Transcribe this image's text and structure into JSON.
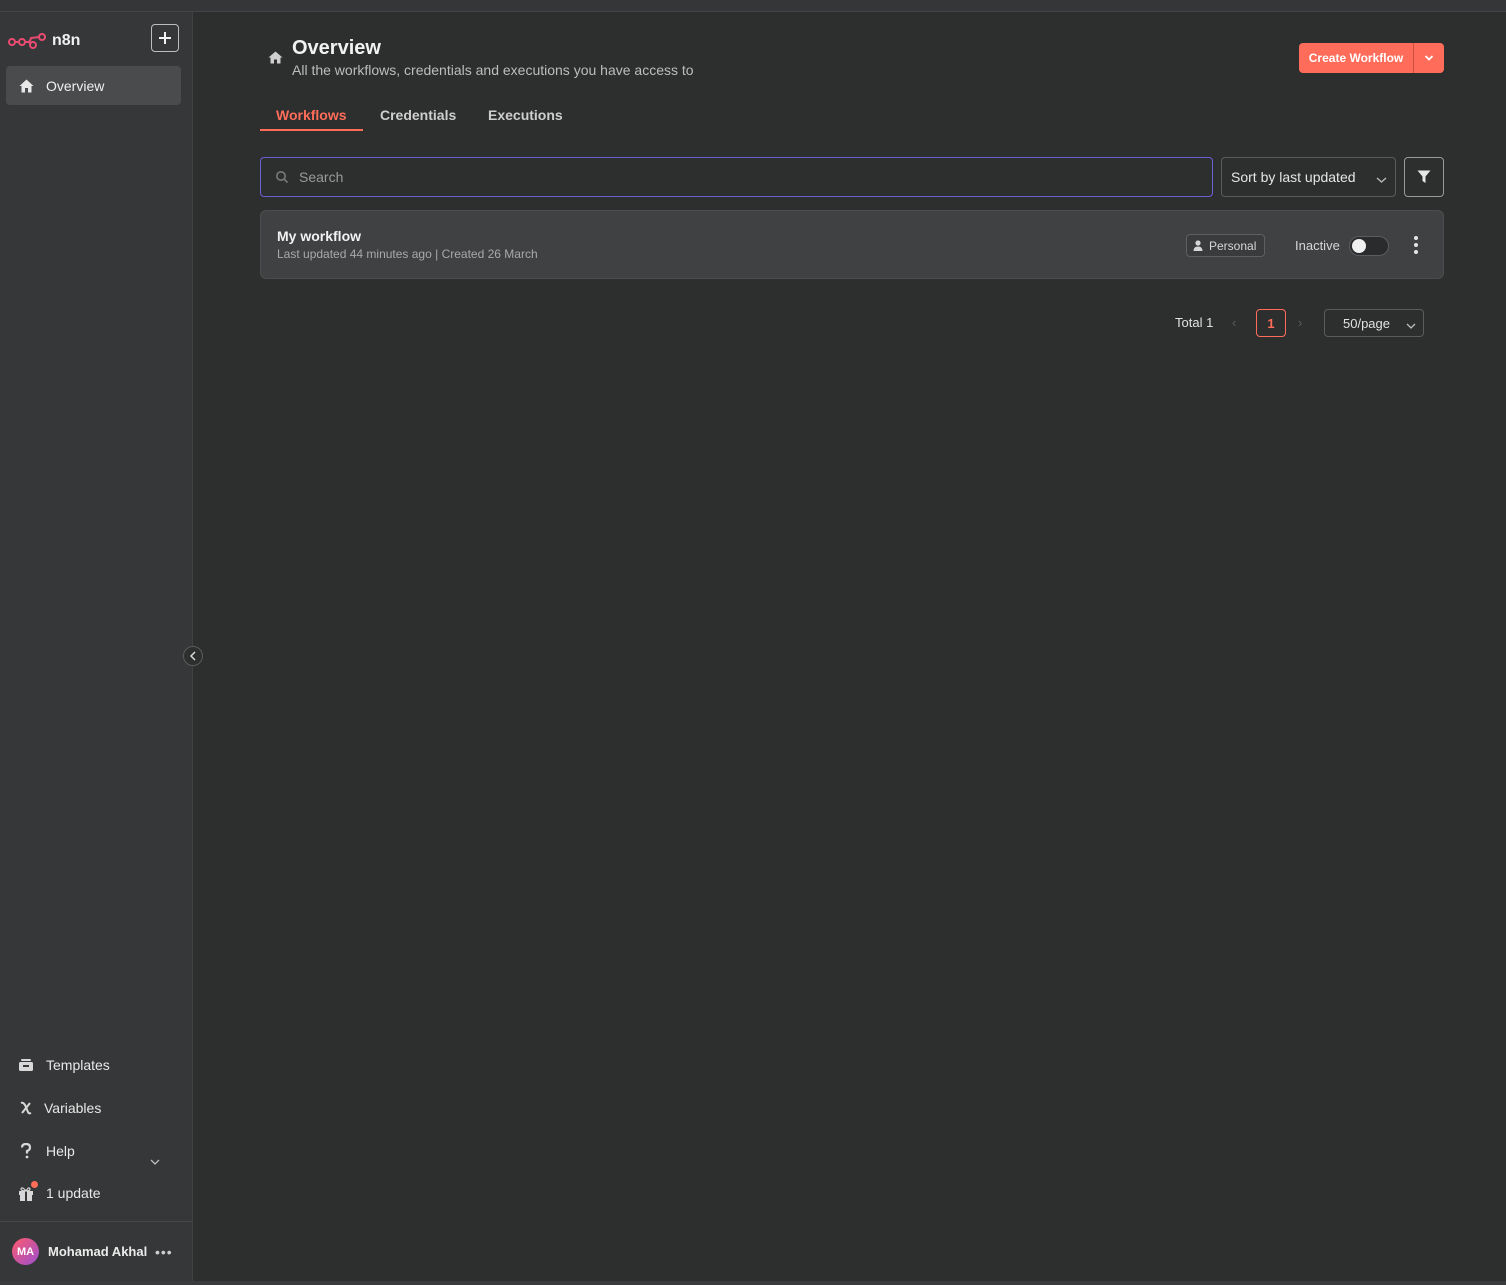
{
  "app": {
    "brand": "n8n",
    "accent_color": "#ff6d5a"
  },
  "sidebar": {
    "add_button_icon": "plus-icon",
    "items": [
      {
        "label": "Overview",
        "icon": "home-icon",
        "active": true
      }
    ],
    "bottom_items": [
      {
        "label": "Templates",
        "icon": "templates-icon"
      },
      {
        "label": "Variables",
        "icon": "variables-icon"
      },
      {
        "label": "Help",
        "icon": "help-icon"
      },
      {
        "label": "1 update",
        "icon": "gift-icon"
      }
    ],
    "user": {
      "initials": "MA",
      "name": "Mohamad Akhal"
    }
  },
  "header": {
    "title": "Overview",
    "subtitle": "All the workflows, credentials and executions you have access to",
    "create_button": "Create Workflow"
  },
  "tabs": [
    {
      "label": "Workflows",
      "active": true
    },
    {
      "label": "Credentials",
      "active": false
    },
    {
      "label": "Executions",
      "active": false
    }
  ],
  "toolbar": {
    "search_placeholder": "Search",
    "sort_label": "Sort by last updated"
  },
  "workflows": [
    {
      "name": "My workflow",
      "meta": "Last updated 44 minutes ago | Created 26 March",
      "owner_badge": "Personal",
      "status": "Inactive",
      "active": false
    }
  ],
  "pagination": {
    "total": "Total 1",
    "current_page": "1",
    "page_size": "50/page"
  }
}
